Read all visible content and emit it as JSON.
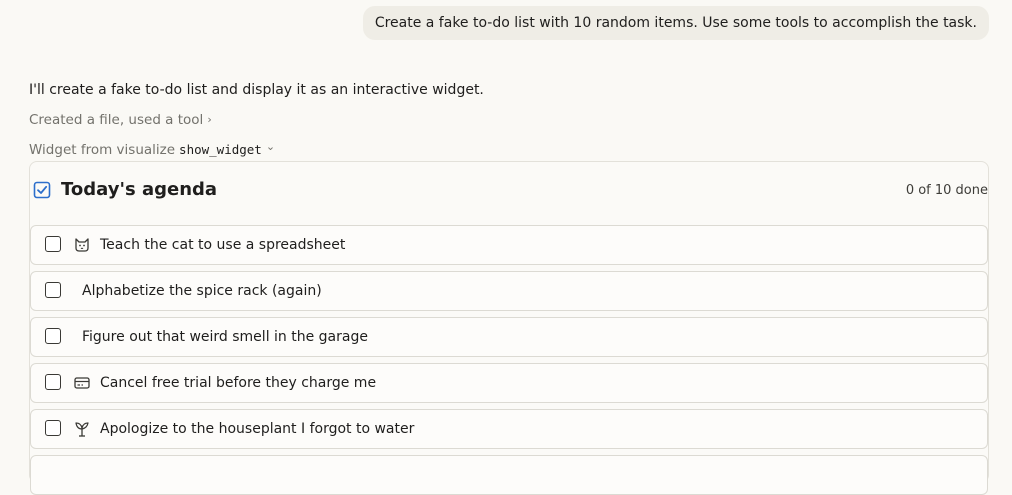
{
  "user_message": "Create a fake to-do list with 10 random items. Use some tools to accomplish the task.",
  "assistant_message": "I'll create a fake to-do list and display it as an interactive widget.",
  "tool_summary": {
    "label": "Created a file, used a tool",
    "chevron": "›"
  },
  "widget_source": {
    "prefix": "Widget from visualize",
    "name": "show_widget",
    "chevron": "⌄"
  },
  "widget": {
    "title": "Today's agenda",
    "title_icon": "checkbox-checked-icon",
    "progress": "0 of 10 done",
    "accent_color": "#2c6ecb",
    "tasks": [
      {
        "label": "Teach the cat to use a spreadsheet",
        "icon": "cat-icon",
        "done": false
      },
      {
        "label": "Alphabetize the spice rack (again)",
        "icon": null,
        "done": false
      },
      {
        "label": "Figure out that weird smell in the garage",
        "icon": null,
        "done": false
      },
      {
        "label": "Cancel free trial before they charge me",
        "icon": "credit-card-icon",
        "done": false
      },
      {
        "label": "Apologize to the houseplant I forgot to water",
        "icon": "plant-icon",
        "done": false
      }
    ]
  }
}
